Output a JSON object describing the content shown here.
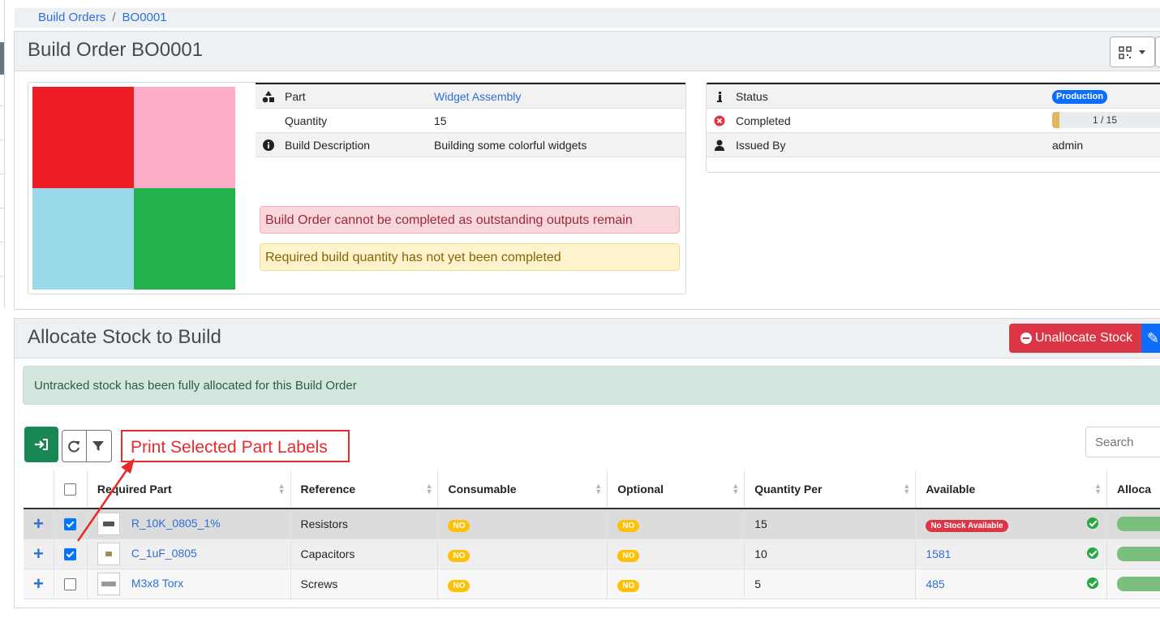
{
  "breadcrumb": {
    "items": [
      "Build Orders",
      "BO0001"
    ]
  },
  "header": {
    "title": "Build Order BO0001",
    "qr_icon": "qr-code-icon"
  },
  "build_image": {
    "colors": [
      "#ee1c25",
      "#feaec9",
      "#99d9ea",
      "#22b14c"
    ]
  },
  "details": {
    "part_label": "Part",
    "part_value": "Widget Assembly",
    "quantity_label": "Quantity",
    "quantity_value": "15",
    "description_label": "Build Description",
    "description_value": "Building some colorful widgets"
  },
  "alerts": {
    "danger": "Build Order cannot be completed as outstanding outputs remain",
    "warning": "Required build quantity has not yet been completed"
  },
  "status": {
    "status_label": "Status",
    "status_badge": "Production",
    "completed_label": "Completed",
    "completed_text": "1 / 15",
    "completed_fraction": 0.0667,
    "issued_label": "Issued By",
    "issued_value": "admin"
  },
  "allocate": {
    "title": "Allocate Stock to Build",
    "unallocate_label": "Unallocate Stock",
    "success_alert": "Untracked stock has been fully allocated for this Build Order",
    "annotation": "Print Selected Part Labels",
    "search_placeholder": "Search",
    "columns": [
      "Required Part",
      "Reference",
      "Consumable",
      "Optional",
      "Quantity Per",
      "Available",
      "Alloca"
    ],
    "rows": [
      {
        "checked": true,
        "part": "R_10K_0805_1%",
        "reference": "Resistors",
        "consumable": "NO",
        "optional": "NO",
        "quantity": "15",
        "available": "No Stock Available"
      },
      {
        "checked": true,
        "part": "C_1uF_0805",
        "reference": "Capacitors",
        "consumable": "NO",
        "optional": "NO",
        "quantity": "10",
        "available": "1581"
      },
      {
        "checked": false,
        "part": "M3x8 Torx",
        "reference": "Screws",
        "consumable": "NO",
        "optional": "NO",
        "quantity": "5",
        "available": "485"
      }
    ]
  },
  "colors": {
    "primary": "#0d6efd",
    "danger": "#dc3545",
    "success": "#198754",
    "warning": "#ffc107",
    "annotation": "#e52b2b"
  }
}
